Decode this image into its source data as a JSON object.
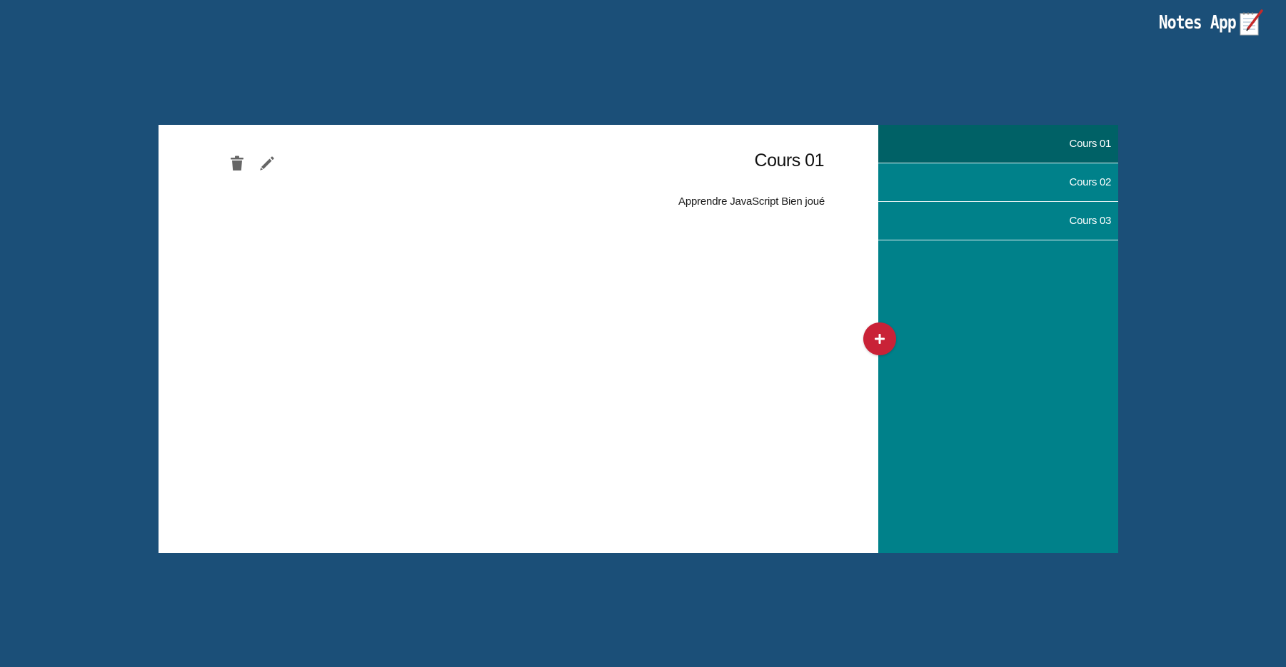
{
  "header": {
    "logo_text": "Notes App",
    "logo_icon": "notepad-pencil-icon"
  },
  "note": {
    "title": "Cours 01",
    "body": "Apprendre JavaScript Bien joué",
    "actions": {
      "delete_icon": "trash-icon",
      "edit_icon": "pencil-icon"
    }
  },
  "sidebar": {
    "items": [
      {
        "label": "Cours 01",
        "active": true
      },
      {
        "label": "Cours 02",
        "active": false
      },
      {
        "label": "Cours 03",
        "active": false
      }
    ]
  },
  "add_button": {
    "icon": "plus-icon"
  },
  "colors": {
    "background": "#1b4f78",
    "sidebar": "#00818a",
    "sidebar_active": "#006166",
    "add_button": "#c92237",
    "icon": "#666666"
  }
}
